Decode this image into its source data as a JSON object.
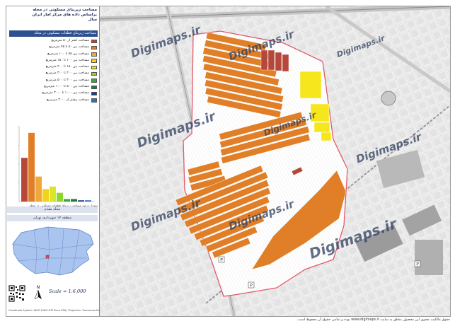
{
  "legend": {
    "title_lines": [
      "مساحت زیربنای مسکونی در محله",
      "براساس داده های مرکز آمار ایران",
      "سال"
    ],
    "heading": "مساحت زیربنای قطعات مسکونی در محله",
    "items": [
      {
        "label": "مساحت کمتر از ۵۰ مترمربع",
        "color": "#b5483a"
      },
      {
        "label": "مساحت بین ۵۰ تا ۷۵ مترمربع",
        "color": "#e07f27"
      },
      {
        "label": "مساحت بین ۷۵ تا ۱۰۰ مترمربع",
        "color": "#f0a83a"
      },
      {
        "label": "مساحت بین ۱۰۰ تا ۱۵۰ مترمربع",
        "color": "#f3d21a"
      },
      {
        "label": "مساحت بین ۱۵۰ تا ۲۰۰ مترمربع",
        "color": "#d9e62a"
      },
      {
        "label": "مساحت بین ۲۰۰ تا ۳۰۰ مترمربع",
        "color": "#8fd62c"
      },
      {
        "label": "مساحت بین ۳۰۰ تا ۵۰۰ مترمربع",
        "color": "#3ca833"
      },
      {
        "label": "مساحت بین ۵۰۰ تا ۱۰۰۰ مترمربع",
        "color": "#1e7a3c"
      },
      {
        "label": "مساحت بین ۱۰۰۰ تا ۳۰۰۰ مترمربع",
        "color": "#1f3a8a"
      },
      {
        "label": "مساحت بیشتر از ۳۰۰۰ مترمربع",
        "color": "#2a74b8"
      }
    ]
  },
  "chart_data": {
    "type": "bar",
    "categories": [
      "<50",
      "50-75",
      "75-100",
      "100-150",
      "150-200",
      "200-300",
      "300-500",
      "500-1000",
      "1000-3000",
      ">3000"
    ],
    "values": [
      0.35,
      0.55,
      0.2,
      0.1,
      0.12,
      0.07,
      0.02,
      0.02,
      0.01,
      0.01
    ],
    "colors": [
      "#b5483a",
      "#e07f27",
      "#f0a83a",
      "#f3d21a",
      "#d9e62a",
      "#8fd62c",
      "#3ca833",
      "#1e7a3c",
      "#1f3a8a",
      "#2a74b8"
    ],
    "ylim": [
      0,
      0.6
    ],
    "ytick_labels": [
      "",
      "",
      "",
      ""
    ],
    "grid": false
  },
  "chart_caption": "نمودار درصد مساحت زیربنای قطعات مسکونی در محله",
  "index_map": {
    "title": "محله مقدم",
    "subtitle": "منطقه ۱۷ شهرداری تهران"
  },
  "footer": {
    "scale": "Scale = 1:6,000",
    "credit": "Coordinate System: WGS 1984 UTM Zone 39N | Projection: Transverse Mercator"
  },
  "map": {
    "watermark": "Digimaps.ir",
    "boundary_color": "#e05a6a",
    "base_bg": "#f4f4f4",
    "dominant_color": "#e07f27",
    "yellow_color": "#f5e61e",
    "red_color": "#b5483a"
  },
  "bottom_note": "حقوق مالکیت معنوی این محصول متعلق به سایت www.digimaps.ir بوده و تمامی حقوق آن محفوظ است."
}
